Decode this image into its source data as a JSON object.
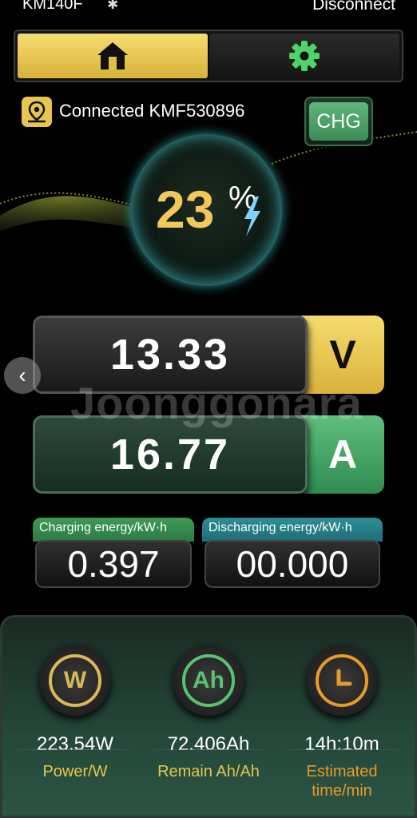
{
  "status_bar": {
    "device": "KM140F",
    "bluetooth_icon": "bluetooth-icon",
    "disconnect": "Disconnect"
  },
  "tabs": [
    {
      "name": "home",
      "icon": "home-icon",
      "active": true
    },
    {
      "name": "settings",
      "icon": "gear-icon",
      "active": false
    }
  ],
  "connection": {
    "text": "Connected KMF530896",
    "icon": "location-pin-icon"
  },
  "mode_badge": "CHG",
  "battery": {
    "percent": "23",
    "sign": "%"
  },
  "voltage": {
    "value": "13.33",
    "unit": "V"
  },
  "current": {
    "value": "16.77",
    "unit": "A"
  },
  "watermark": "Joonggonara",
  "energy": {
    "charging": {
      "label": "Charging energy/kW·h",
      "value": "0.397"
    },
    "discharging": {
      "label": "Discharging energy/kW·h",
      "value": "00.000"
    }
  },
  "stats": [
    {
      "icon_text": "W",
      "value": "223.54W",
      "label": "Power/W",
      "color": "#d9b858"
    },
    {
      "icon_text": "Ah",
      "value": "72.406Ah",
      "label": "Remain Ah/Ah",
      "color": "#58c26e"
    },
    {
      "icon_text": "",
      "value": "14h:10m",
      "label": "Estimated time/min",
      "color": "#e89a28"
    }
  ],
  "colors": {
    "accent_yellow": "#e6c64f",
    "accent_green": "#4caf6a",
    "accent_teal": "#2d8f98"
  }
}
